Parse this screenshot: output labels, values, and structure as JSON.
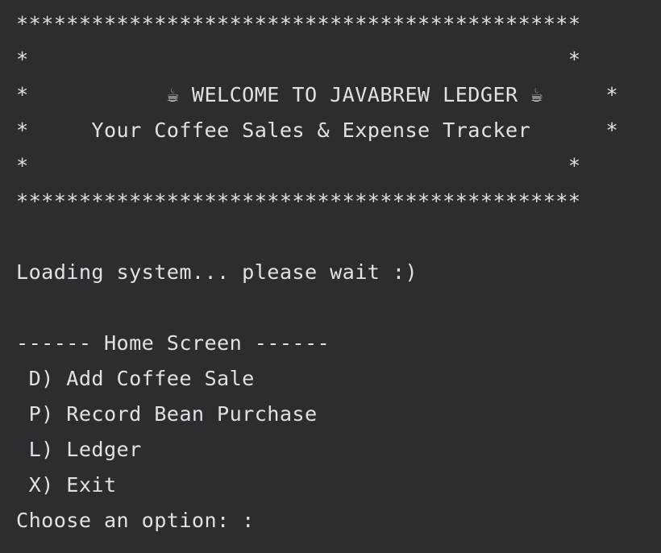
{
  "console": {
    "banner": {
      "top_border": "*********************************************",
      "blank_line_1": "*                                           *",
      "title_line": "*           ☕ WELCOME TO JAVABREW LEDGER ☕     *",
      "subtitle_line": "*     Your Coffee Sales & Expense Tracker      *",
      "blank_line_2": "*                                           *",
      "bottom_border": "*********************************************"
    },
    "loading_message": "Loading system... please wait :)",
    "home_screen": {
      "header": "------ Home Screen ------",
      "options": [
        {
          "key": "D",
          "label": " D) Add Coffee Sale"
        },
        {
          "key": "P",
          "label": " P) Record Bean Purchase"
        },
        {
          "key": "L",
          "label": " L) Ledger"
        },
        {
          "key": "X",
          "label": " X) Exit"
        }
      ]
    },
    "prompt": "Choose an option: :"
  },
  "colors": {
    "background": "#2b2d30",
    "text": "#dfe1e5"
  }
}
